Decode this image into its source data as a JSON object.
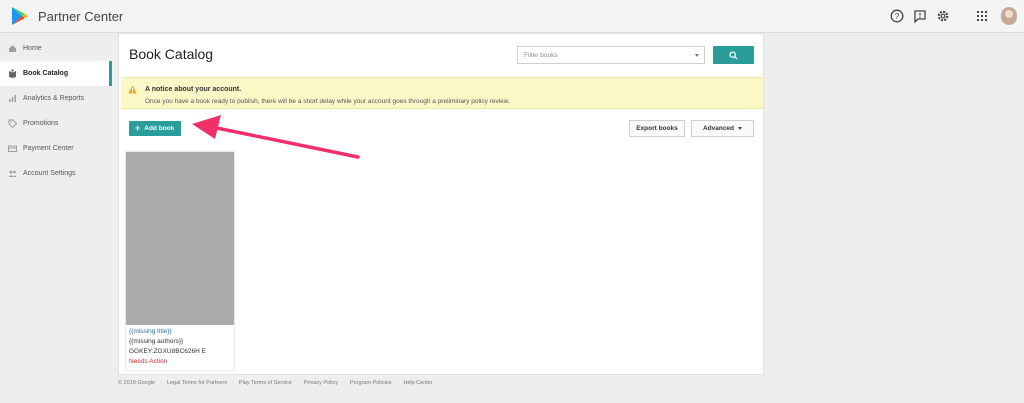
{
  "header": {
    "app_title": "Partner Center",
    "icons": [
      "help-icon",
      "feedback-icon",
      "settings-icon",
      "apps-grid-icon",
      "avatar"
    ]
  },
  "sidebar": {
    "items": [
      {
        "label": "Home",
        "icon": "home-icon",
        "active": false
      },
      {
        "label": "Book Catalog",
        "icon": "book-icon",
        "active": true
      },
      {
        "label": "Analytics & Reports",
        "icon": "chart-icon",
        "active": false
      },
      {
        "label": "Promotions",
        "icon": "tag-icon",
        "active": false
      },
      {
        "label": "Payment Center",
        "icon": "card-icon",
        "active": false
      },
      {
        "label": "Account Settings",
        "icon": "people-icon",
        "active": false
      }
    ]
  },
  "main": {
    "title": "Book Catalog",
    "filter": {
      "placeholder": "Filter books"
    },
    "search_button_icon": "search-icon",
    "notice": {
      "title": "A notice about your account.",
      "text": "Once you have a book ready to publish, there will be a short delay while your account goes through a preliminary policy review."
    },
    "toolbar": {
      "add_label": "Add book",
      "export_label": "Export books",
      "advanced_label": "Advanced"
    },
    "books": [
      {
        "title": "{{missing title}}",
        "authors": "{{missing authors}}",
        "key": "GGKEY:ZGXU8BC626H E",
        "status": "Needs Action"
      }
    ]
  },
  "footer": {
    "items": [
      "© 2019 Google",
      "Legal Terms for Partners",
      "Play Terms of Service",
      "Privacy Policy",
      "Program Policies",
      "Help Center"
    ]
  },
  "colors": {
    "accent": "#2a9d9a",
    "notice_bg": "#fbf8c8",
    "status_red": "#d32f2f",
    "arrow": "#f0306a"
  }
}
